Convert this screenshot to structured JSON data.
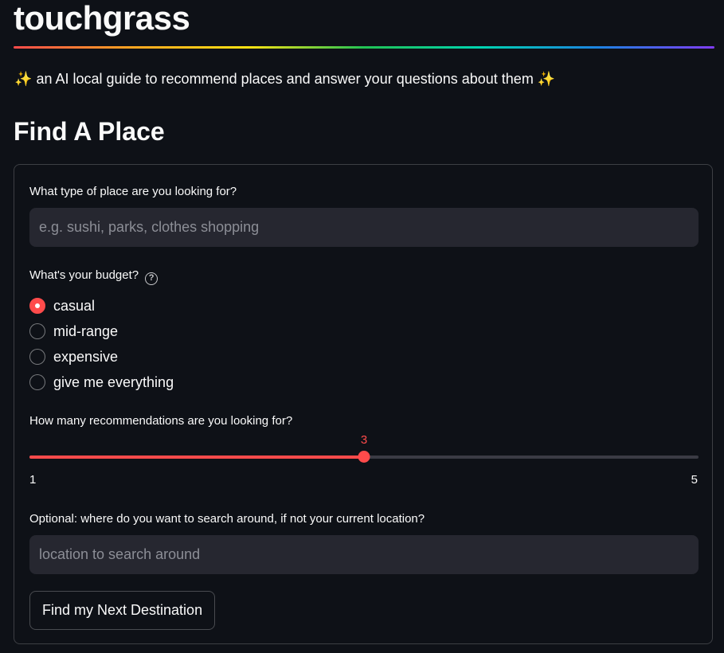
{
  "app": {
    "title": "touchgrass",
    "subtitle_sparkle_left": "✨",
    "subtitle": "an AI local guide to recommend places and answer your questions about them",
    "subtitle_sparkle_right": "✨"
  },
  "section": {
    "title": "Find A Place"
  },
  "form": {
    "place_type": {
      "label": "What type of place are you looking for?",
      "placeholder": "e.g. sushi, parks, clothes shopping",
      "value": ""
    },
    "budget": {
      "label": "What's your budget?",
      "help_icon": "question-circle-icon",
      "selected": "casual",
      "options": [
        "casual",
        "mid-range",
        "expensive",
        "give me everything"
      ]
    },
    "recommendations": {
      "label": "How many recommendations are you looking for?",
      "min": "1",
      "max": "5",
      "value": "3"
    },
    "location": {
      "label": "Optional: where do you want to search around, if not your current location?",
      "placeholder": "location to search around",
      "value": ""
    },
    "submit_label": "Find my Next Destination"
  },
  "colors": {
    "accent": "#ff4b4b",
    "background": "#0e1117",
    "input_background": "#262730"
  }
}
